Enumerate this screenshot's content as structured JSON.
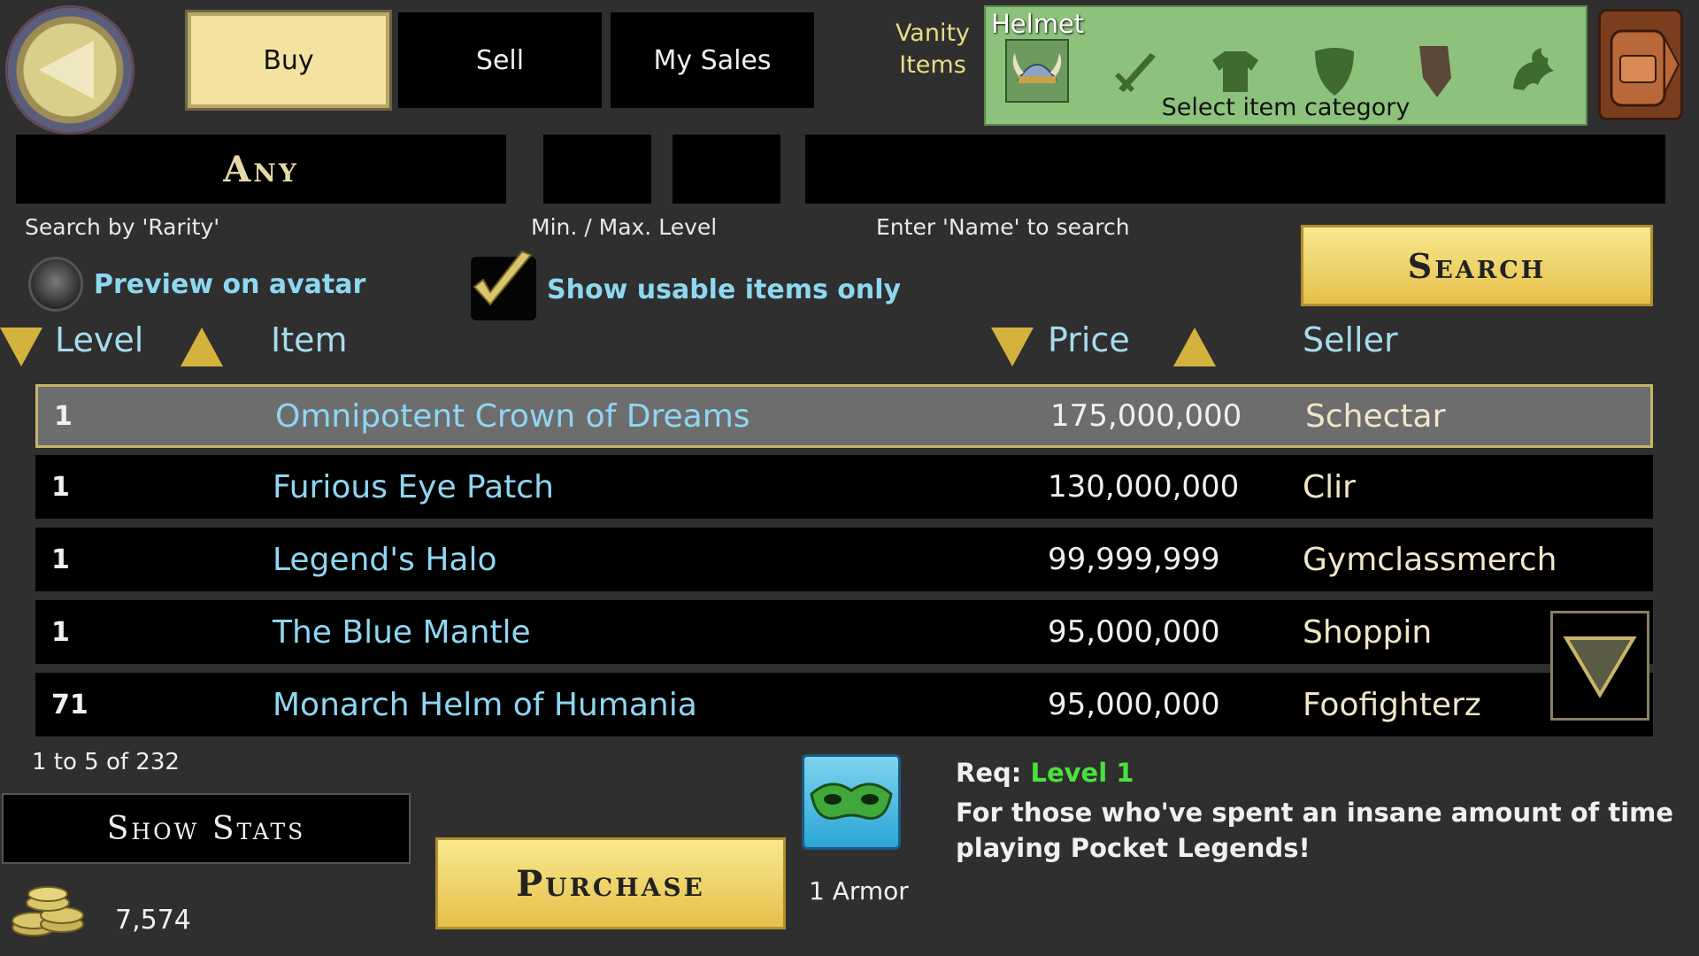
{
  "header": {
    "tabs": [
      {
        "label": "Buy",
        "active": true
      },
      {
        "label": "Sell",
        "active": false
      },
      {
        "label": "My Sales",
        "active": false
      }
    ],
    "vanity_label": "Vanity Items",
    "category_panel": {
      "title": "Helmet",
      "caption": "Select item category",
      "categories": [
        {
          "icon": "viking-helmet-icon",
          "selected": true
        },
        {
          "icon": "sword-icon",
          "selected": false
        },
        {
          "icon": "armor-shirt-icon",
          "selected": false
        },
        {
          "icon": "shield-icon",
          "selected": false
        },
        {
          "icon": "cape-icon",
          "selected": false
        },
        {
          "icon": "pet-icon",
          "selected": false
        }
      ]
    }
  },
  "search": {
    "rarity_value": "Any",
    "rarity_hint": "Search by 'Rarity'",
    "level_hint": "Min. / Max. Level",
    "name_hint": "Enter 'Name' to search",
    "search_button": "Search"
  },
  "options": {
    "preview_label": "Preview on avatar",
    "preview_checked": false,
    "usable_label": "Show usable items only",
    "usable_checked": true
  },
  "table": {
    "headers": {
      "level": "Level",
      "item": "Item",
      "price": "Price",
      "seller": "Seller"
    },
    "rows": [
      {
        "level": "1",
        "item": "Omnipotent Crown of Dreams",
        "price": "175,000,000",
        "seller": "Schectar",
        "selected": true
      },
      {
        "level": "1",
        "item": "Furious Eye Patch",
        "price": "130,000,000",
        "seller": "Clir",
        "selected": false
      },
      {
        "level": "1",
        "item": "Legend's Halo",
        "price": "99,999,999",
        "seller": "Gymclassmerch",
        "selected": false
      },
      {
        "level": "1",
        "item": "The Blue Mantle",
        "price": "95,000,000",
        "seller": "Shoppin",
        "selected": false
      },
      {
        "level": "71",
        "item": "Monarch Helm of Humania",
        "price": "95,000,000",
        "seller": "Foofighterz",
        "selected": false
      }
    ],
    "paging": "1 to 5 of 232"
  },
  "footer": {
    "show_stats": "Show Stats",
    "purchase": "Purchase",
    "gold": "7,574",
    "armor": "1 Armor",
    "req_prefix": "Req:",
    "req_level": "Level 1",
    "description": "For those who've spent an insane amount of time playing Pocket Legends!"
  },
  "colors": {
    "background": "#2f2f2f",
    "accent_gold": "#e5c04a",
    "item_name": "#8fd6f2",
    "vanity_panel": "#8dc27c",
    "req_level": "#49e23d"
  }
}
